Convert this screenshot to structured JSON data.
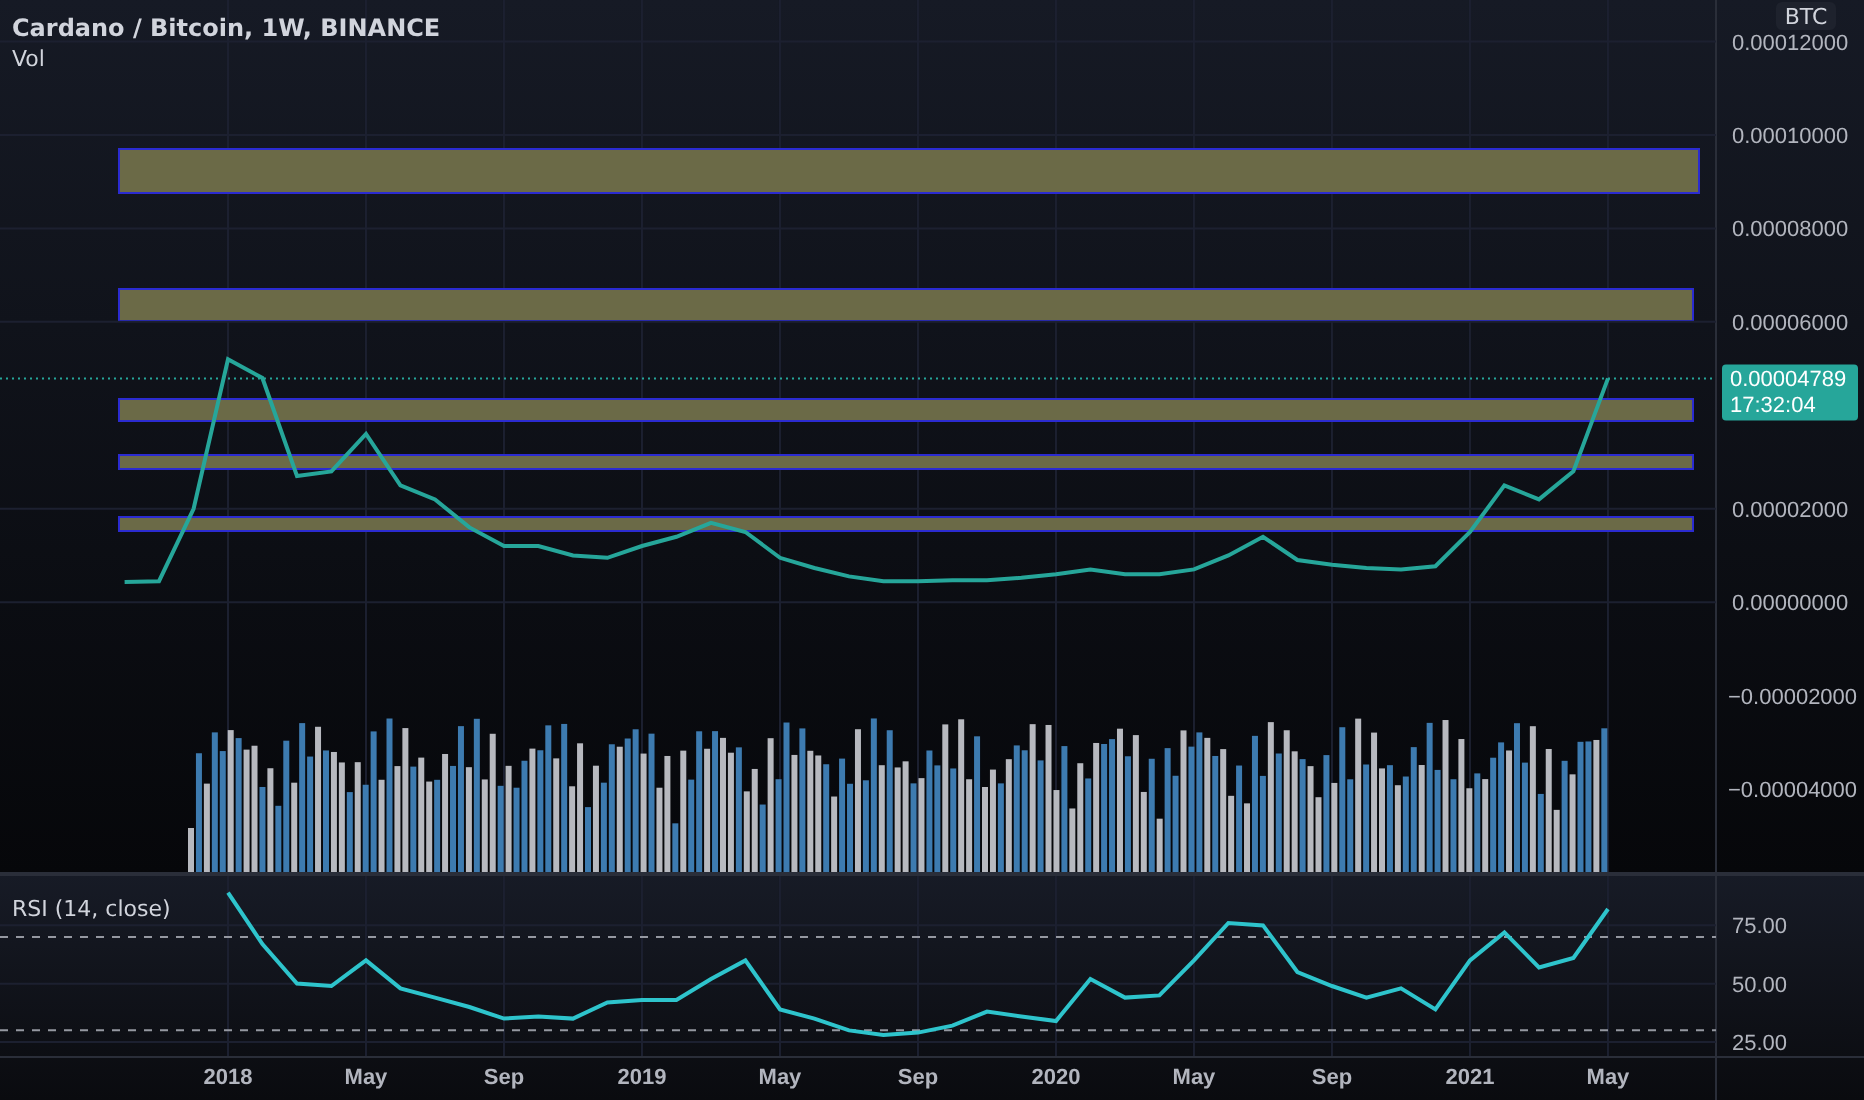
{
  "header": {
    "title": "Cardano / Bitcoin, 1W, BINANCE",
    "volume_label": "Vol"
  },
  "currency_badge": "BTC",
  "price_chart": {
    "chart_data": {
      "type": "line",
      "grid": true,
      "series": [
        {
          "color": "#26a69a",
          "values": [
            4.3e-06,
            4.5e-06,
            2e-05,
            5.2e-05,
            4.8e-05,
            2.7e-05,
            2.8e-05,
            3.6e-05,
            2.5e-05,
            2.2e-05,
            1.6e-05,
            1.2e-05,
            1.2e-05,
            1e-05,
            9.5e-06,
            1.2e-05,
            1.4e-05,
            1.7e-05,
            1.5e-05,
            9.5e-06,
            7.3e-06,
            5.5e-06,
            4.5e-06,
            4.5e-06,
            4.7e-06,
            4.7e-06,
            5.2e-06,
            6e-06,
            7e-06,
            6e-06,
            6e-06,
            7e-06,
            1e-05,
            1.4e-05,
            9e-06,
            8e-06,
            7.3e-06,
            7e-06,
            7.7e-06,
            1.5e-05,
            2.5e-05,
            2.2e-05,
            2.8e-05,
            4.79e-05
          ]
        }
      ],
      "yticks": [
        {
          "value": -4e-05,
          "label": "−0.00004000"
        },
        {
          "value": -2e-05,
          "label": "−0.00002000"
        },
        {
          "value": 0,
          "label": "0.00000000"
        },
        {
          "value": 2e-05,
          "label": "0.00002000"
        },
        {
          "value": 6e-05,
          "label": "0.00006000"
        },
        {
          "value": 8e-05,
          "label": "0.00008000"
        },
        {
          "value": 0.0001,
          "label": "0.00010000"
        },
        {
          "value": 0.00012,
          "label": "0.00012000"
        }
      ],
      "ylim": [
        -5.82e-05,
        0.0001289
      ]
    }
  },
  "last_price": {
    "price": "0.00004789",
    "countdown": "17:32:04"
  },
  "rsi": {
    "label": "RSI (14, close)",
    "chart_data": {
      "type": "line",
      "categories": [
        null,
        null,
        null,
        "2018",
        null,
        null,
        null,
        "May",
        null,
        null,
        null,
        "Sep",
        null,
        null,
        null,
        "2019",
        null,
        null,
        null,
        "May",
        null,
        null,
        null,
        "Sep",
        null,
        null,
        null,
        "2020",
        null,
        null,
        null,
        "May",
        null,
        null,
        null,
        "Sep",
        null,
        null,
        null,
        "2021",
        null,
        null,
        null,
        "May"
      ],
      "series": [
        {
          "color": "#2ec4cc",
          "values": [
            null,
            null,
            null,
            89,
            67,
            50,
            49,
            60,
            48,
            44,
            40,
            35,
            36,
            35,
            42,
            43,
            43,
            52,
            60,
            39,
            35,
            30,
            28,
            29,
            32,
            38,
            36,
            34,
            52,
            44,
            45,
            60,
            76,
            75,
            55,
            49,
            44,
            48,
            39,
            60,
            72,
            57,
            61,
            82
          ]
        }
      ],
      "yticks": [
        {
          "value": 25,
          "label": "25.00"
        },
        {
          "value": 50,
          "label": "50.00"
        },
        {
          "value": 75,
          "label": "75.00"
        }
      ],
      "ylim": [
        19,
        97
      ],
      "grid": true
    }
  }
}
